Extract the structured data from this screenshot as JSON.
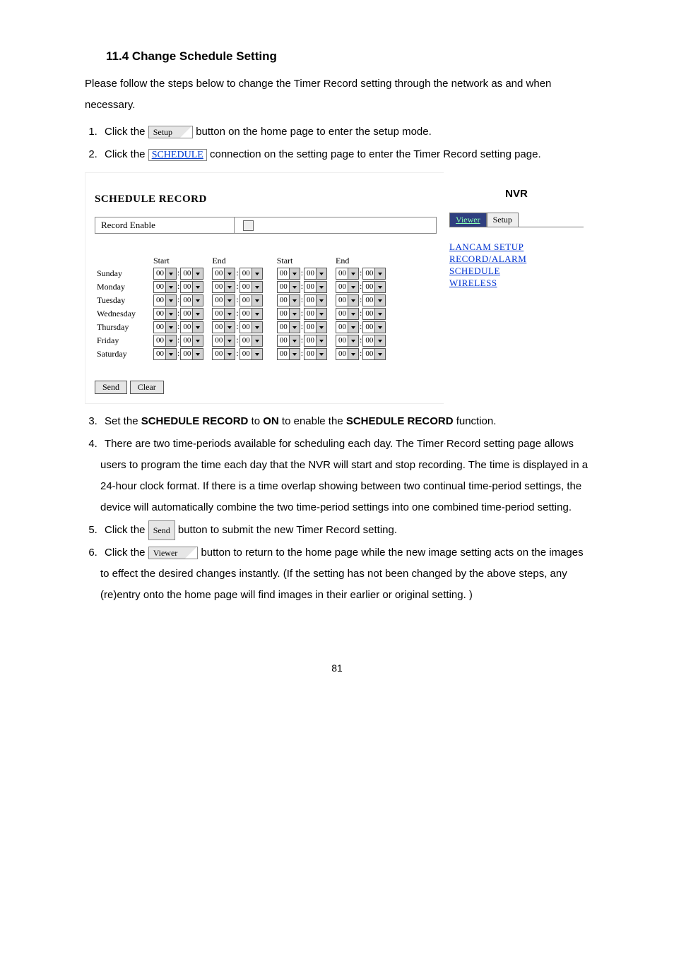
{
  "page": {
    "title": "11.4 Change Schedule Setting",
    "intro": "Please follow the steps below to change the Timer Record setting through the network as and when necessary.",
    "page_num": "81"
  },
  "steps": {
    "s1_a": "Click the ",
    "s1_btn": "Setup",
    "s1_b": " button on the home page to enter the setup mode.",
    "s2_a": "Click the ",
    "s2_link": "SCHEDULE",
    "s2_b": " connection on the setting page to enter the Timer Record setting page.",
    "s3_a": "Set the ",
    "s3_kw1": "SCHEDULE RECORD",
    "s3_b": " to ",
    "s3_kw2": "ON",
    "s3_c": " to enable the ",
    "s3_kw3": "SCHEDULE RECORD",
    "s3_d": " function.",
    "s4": "There are two time-periods available for scheduling each day. The Timer Record setting page allows users to program the time each day that the NVR will start and stop recording. The time is displayed in a 24-hour clock format. If there is a time overlap showing between two continual time-period settings, the device will automatically combine the two time-period settings into one combined time-period setting.",
    "s5_a": "Click the ",
    "s5_btn": "Send",
    "s5_b": " button to submit the new Timer Record setting.",
    "s6_a": "Click the ",
    "s6_btn": "Viewer",
    "s6_b": " button to return to the home page while the new image setting acts on the images to effect the desired changes instantly. (If the setting has not been changed by the above steps, any (re)entry onto the home page will find images in their earlier or original setting. )"
  },
  "shot": {
    "main_title": "SCHEDULE RECORD",
    "record_enable_label": "Record Enable",
    "col_start": "Start",
    "col_end": "End",
    "opt": "00",
    "days": [
      "Sunday",
      "Monday",
      "Tuesday",
      "Wednesday",
      "Thursday",
      "Friday",
      "Saturday"
    ],
    "send": "Send",
    "clear": "Clear",
    "right": {
      "title": "NVR",
      "tab_viewer": "Viewer",
      "tab_setup": "Setup",
      "links": [
        "LANCAM SETUP",
        "RECORD/ALARM",
        "SCHEDULE",
        "WIRELESS"
      ]
    }
  }
}
